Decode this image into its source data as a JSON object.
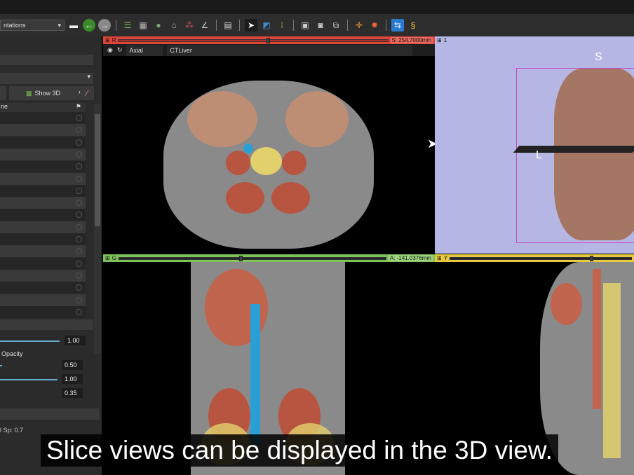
{
  "toolbar": {
    "module_selector": "ntations",
    "icons": [
      "layout-icon",
      "back-icon",
      "forward-icon",
      "data-icon",
      "dcm-icon",
      "volume-icon",
      "models-icon",
      "segment-icon",
      "markups-icon",
      "layout-grid-icon",
      "pointer-icon",
      "window-level-icon",
      "crosshair-icon",
      "screenshot-icon",
      "capture-icon",
      "transform-icon",
      "fiducial-icon",
      "extension-icon",
      "python-icon"
    ]
  },
  "left_panel": {
    "show3d_label": "Show 3D",
    "name_header": "ne",
    "row_count": 17,
    "opacity_label": "Opacity",
    "values": [
      "1.00",
      "0.50",
      "1.00",
      "0.35"
    ],
    "status": "l Sp: 0.7"
  },
  "views": {
    "red": {
      "label": "R",
      "offset": "S: 254.7000mm",
      "orientation": "Axial",
      "volume": "CTLiver",
      "slider_fraction": 0.55
    },
    "threed": {
      "label": "1",
      "axis_s": "S",
      "axis_l": "L"
    },
    "green": {
      "label": "G",
      "offset": "A: -141.0376mm",
      "slider_fraction": 0.45
    },
    "yellow": {
      "label": "Y",
      "slider_fraction": 0.77
    }
  },
  "subtitle": "Slice views can be displayed in the 3D view.",
  "colors": {
    "red": "#e0453a",
    "green": "#7ec25a",
    "yellow": "#e9c93e",
    "threed_bg": "#b5b6e4"
  }
}
